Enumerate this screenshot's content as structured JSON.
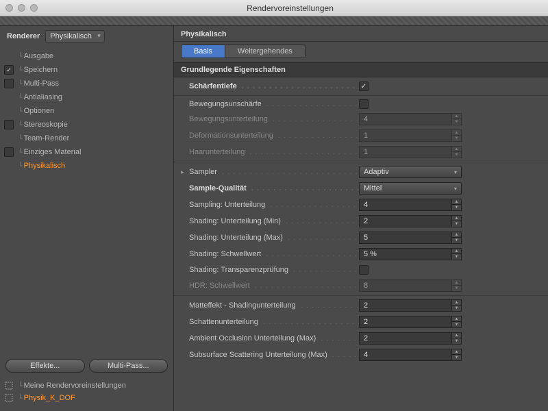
{
  "window": {
    "title": "Rendervoreinstellungen"
  },
  "sidebar": {
    "renderer_label": "Renderer",
    "renderer_value": "Physikalisch",
    "tree": [
      {
        "label": "Ausgabe",
        "checkbox": null
      },
      {
        "label": "Speichern",
        "checkbox": true
      },
      {
        "label": "Multi-Pass",
        "checkbox": false
      },
      {
        "label": "Antialiasing",
        "checkbox": null
      },
      {
        "label": "Optionen",
        "checkbox": null
      },
      {
        "label": "Stereoskopie",
        "checkbox": false
      },
      {
        "label": "Team-Render",
        "checkbox": null
      },
      {
        "label": "Einziges Material",
        "checkbox": false
      },
      {
        "label": "Physikalisch",
        "checkbox": null,
        "active": true
      }
    ],
    "effects_btn": "Effekte...",
    "multipass_btn": "Multi-Pass...",
    "presets": [
      {
        "label": "Meine Rendervoreinstellungen",
        "active": false
      },
      {
        "label": "Physik_K_DOF",
        "active": true
      }
    ]
  },
  "content": {
    "header": "Physikalisch",
    "tabs": [
      {
        "label": "Basis",
        "active": true
      },
      {
        "label": "Weitergehendes",
        "active": false
      }
    ],
    "section_title": "Grundlegende Eigenschaften",
    "props": {
      "schaerfentiefe": {
        "label": "Schärfentiefe",
        "checked": true
      },
      "bewegungsunschaerfe": {
        "label": "Bewegungsunschärfe",
        "checked": false
      },
      "bewegungsunterteilung": {
        "label": "Bewegungsunterteilung",
        "value": "4"
      },
      "deformationsunterteilung": {
        "label": "Deformationsunterteilung",
        "value": "1"
      },
      "haarunterteilung": {
        "label": "Haarunterteilung",
        "value": "1"
      },
      "sampler": {
        "label": "Sampler",
        "value": "Adaptiv"
      },
      "sample_qualitaet": {
        "label": "Sample-Qualität",
        "value": "Mittel"
      },
      "sampling_unterteilung": {
        "label": "Sampling: Unterteilung",
        "value": "4"
      },
      "shading_min": {
        "label": "Shading: Unterteilung (Min)",
        "value": "2"
      },
      "shading_max": {
        "label": "Shading: Unterteilung (Max)",
        "value": "5"
      },
      "shading_schwellwert": {
        "label": "Shading: Schwellwert",
        "value": "5 %"
      },
      "shading_transparenz": {
        "label": "Shading: Transparenzprüfung",
        "checked": false
      },
      "hdr_schwellwert": {
        "label": "HDR: Schwellwert",
        "value": "8"
      },
      "matteffekt": {
        "label": "Matteffekt - Shadingunterteilung",
        "value": "2"
      },
      "schatten": {
        "label": "Schattenunterteilung",
        "value": "2"
      },
      "ao": {
        "label": "Ambient Occlusion Unterteilung (Max)",
        "value": "2"
      },
      "sss": {
        "label": "Subsurface Scattering Unterteilung (Max)",
        "value": "4"
      }
    }
  }
}
